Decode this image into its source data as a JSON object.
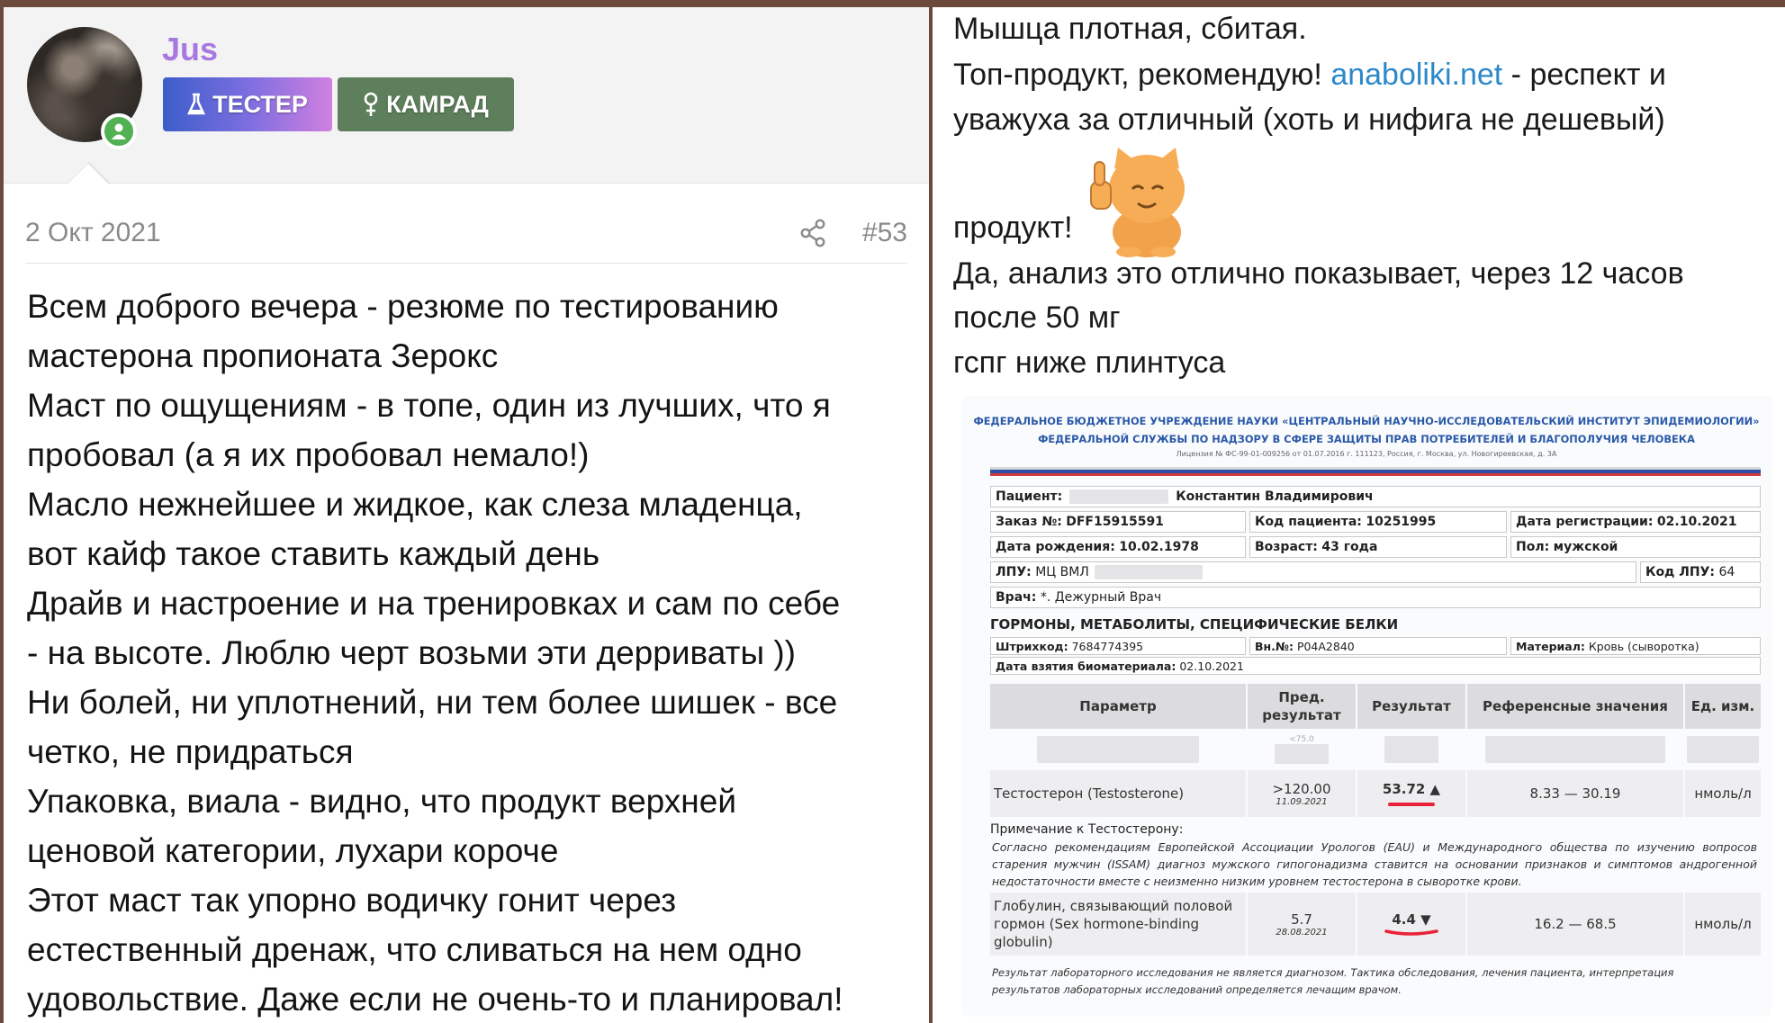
{
  "left_post": {
    "username": "Jus",
    "badges": [
      "ТЕСТЕР",
      "КАМРАД"
    ],
    "date": "2 Окт 2021",
    "post_number": "#53",
    "lines": [
      "Всем доброго вечера - резюме по тестированию",
      "мастерона пропионата Зерокс",
      "Маст по ощущениям - в топе, один из лучших, что я",
      "пробовал (а я их пробовал немало!)",
      "Масло нежнейшее и жидкое, как слеза младенца,",
      "вот кайф такое ставить каждый день",
      "Драйв и настроение и на тренировках и сам по себе",
      "- на высоте. Люблю черт возьми эти дерриваты ))",
      "Ни болей, ни уплотнений, ни тем более шишек - все",
      "четко, не придраться",
      "Упаковка, виала - видно, что продукт верхней",
      "ценовой категории, лухари короче",
      "Этот маст так упорно водичку гонит через",
      "естественный дренаж, что сливаться на нем одно",
      "удовольствие. Даже если не очень-то и планировал!"
    ]
  },
  "right_post": {
    "line1": "Мышца плотная, сбитая.",
    "line2_pre": "Топ-продукт, рекомендую! ",
    "line2_link": "anaboliki.net",
    "line2_post": " - респект и",
    "line3": "уважуха за отличный (хоть и нифига не дешевый)",
    "line4": "продукт!",
    "line5": "Да, анализ это отлично показывает, через 12 часов",
    "line6": "после 50 мг",
    "line7": "гспг ниже плинтуса"
  },
  "lab": {
    "header1": "ФЕДЕРАЛЬНОЕ БЮДЖЕТНОЕ УЧРЕЖДЕНИЕ НАУКИ «ЦЕНТРАЛЬНЫЙ НАУЧНО-ИССЛЕДОВАТЕЛЬСКИЙ ИНСТИТУТ ЭПИДЕМИОЛОГИИ»",
    "header2": "ФЕДЕРАЛЬНОЙ СЛУЖБЫ ПО НАДЗОРУ В СФЕРЕ ЗАЩИТЫ ПРАВ ПОТРЕБИТЕЛЕЙ И БЛАГОПОЛУЧИЯ ЧЕЛОВЕКА",
    "license": "Лицензия № ФС-99-01-009256 от 01.07.2016 г. 111123, Россия, г. Москва, ул. Новогиреевская, д. 3А",
    "patient_label": "Пациент:",
    "patient_name": "Константин Владимирович",
    "order_label": "Заказ №:",
    "order": "DFF15915591",
    "patient_code_label": "Код пациента:",
    "patient_code": "10251995",
    "reg_date_label": "Дата регистрации:",
    "reg_date": "02.10.2021",
    "dob_label": "Дата рождения:",
    "dob": "10.02.1978",
    "age_label": "Возраст:",
    "age": "43 года",
    "sex_label": "Пол:",
    "sex": "мужской",
    "lpu_label": "ЛПУ:",
    "lpu": "МЦ ВМЛ",
    "lpu_code_label": "Код ЛПУ:",
    "lpu_code": "64",
    "doctor_label": "Врач:",
    "doctor": "*. Дежурный Врач",
    "section": "ГОРМОНЫ, МЕТАБОЛИТЫ, СПЕЦИФИЧЕСКИЕ БЕЛКИ",
    "barcode_label": "Штрихкод:",
    "barcode": "7684774395",
    "int_no_label": "Вн.№:",
    "int_no": "P04A2840",
    "material_label": "Материал:",
    "material": "Кровь (сыворотка)",
    "sample_date_label": "Дата взятия биоматериала:",
    "sample_date": "02.10.2021",
    "columns": [
      "Параметр",
      "Пред. результат",
      "Результат",
      "Референсные значения",
      "Ед. изм."
    ],
    "row_hidden_prev": "<75.0",
    "row1": {
      "param": "Тестостерон (Testosterone)",
      "prev": ">120.00",
      "prev_date": "11.09.2021",
      "result": "53.72 ▲",
      "ref": "8.33 — 30.19",
      "unit": "нмоль/л"
    },
    "note_title": "Примечание к Тестостерону:",
    "note_text": "Согласно рекомендациям Европейской Ассоциации Урологов (EAU) и Международного общества по изучению вопросов старения мужчин (ISSAM) диагноз мужского гипогонадизма ставится на основании признаков и симптомов андрогенной недостаточности вместе с неизменно низким уровнем тестостерона в сыворотке крови.",
    "row2": {
      "param1": "Глобулин, связывающий половой",
      "param2": "гормон (Sex hormone-binding",
      "param3": "globulin)",
      "prev": "5.7",
      "prev_date": "28.08.2021",
      "result": "4.4 ▼",
      "ref": "16.2 — 68.5",
      "unit": "нмоль/л"
    },
    "footer1": "Результат лабораторного исследования не является диагнозом. Тактика обследования, лечения пациента, интерпретация",
    "footer2": "результатов лабораторных исследований определяется лечащим врачом."
  }
}
